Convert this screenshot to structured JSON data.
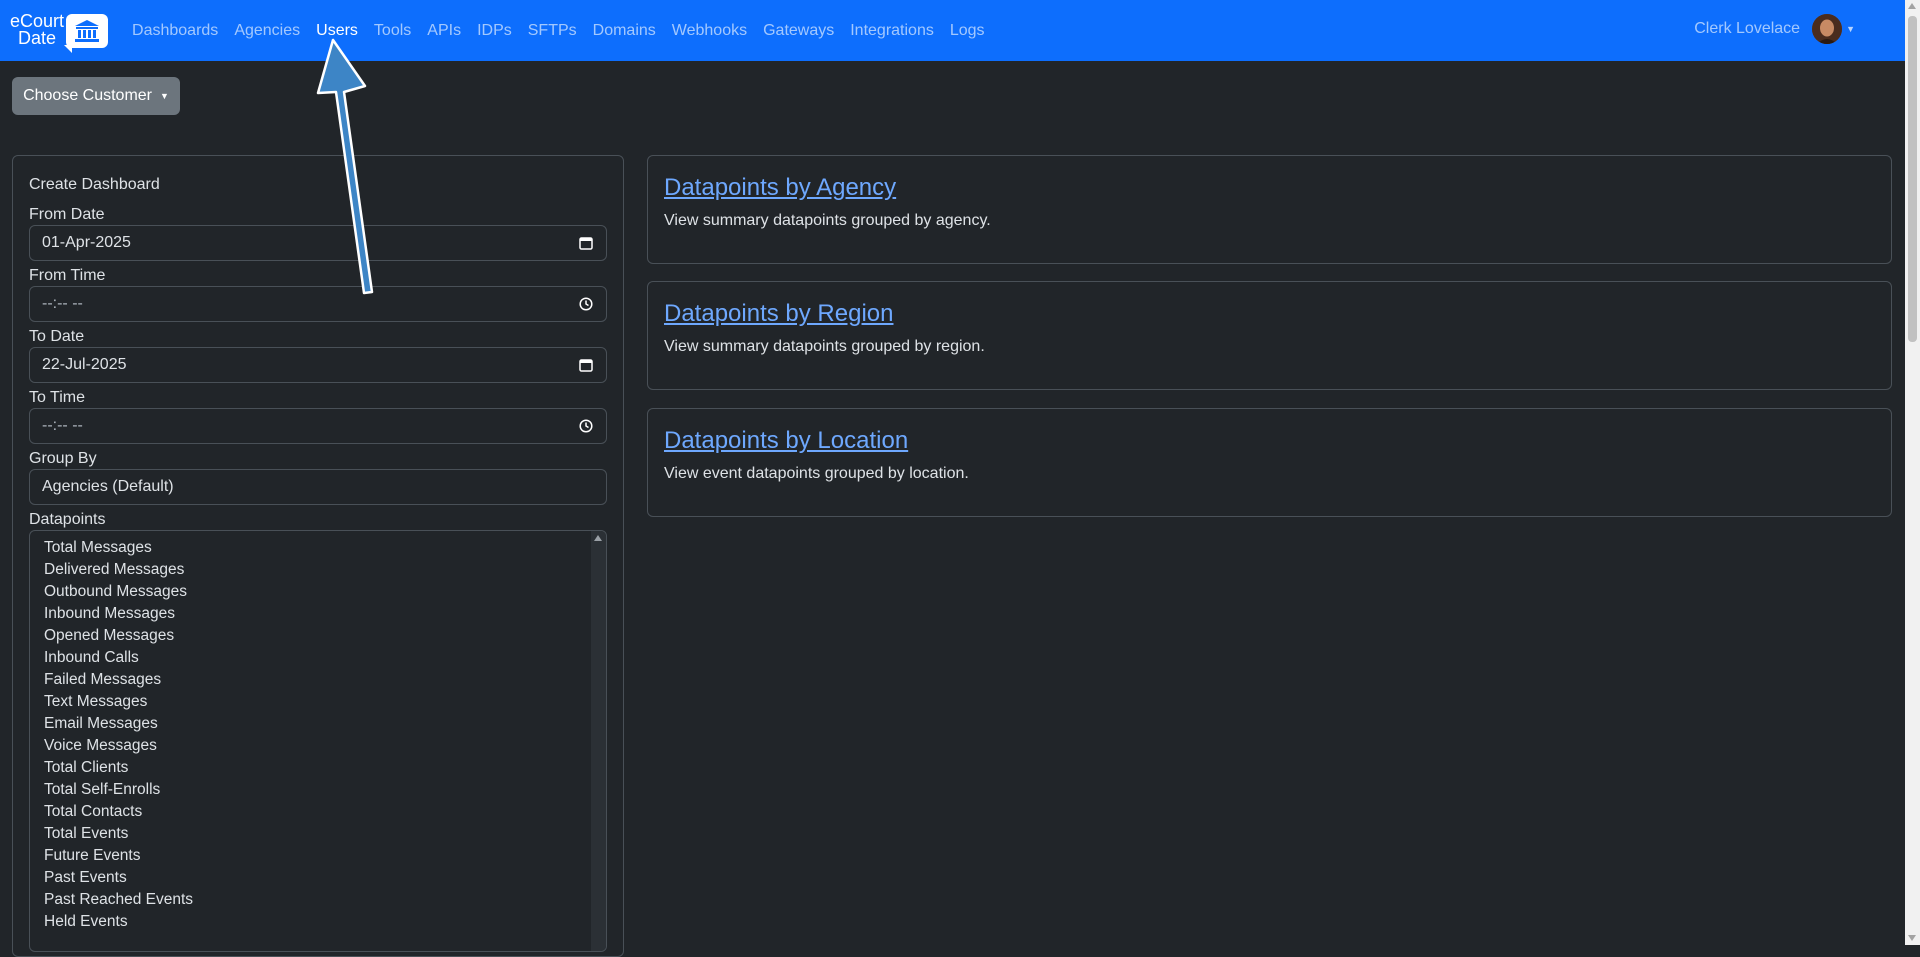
{
  "brand": {
    "line1": "eCourt",
    "line2": "Date"
  },
  "nav": {
    "items": [
      "Dashboards",
      "Agencies",
      "Users",
      "Tools",
      "APIs",
      "IDPs",
      "SFTPs",
      "Domains",
      "Webhooks",
      "Gateways",
      "Integrations",
      "Logs"
    ],
    "active": "Users"
  },
  "user": {
    "name": "Clerk Lovelace"
  },
  "customer": {
    "label": "Choose Customer"
  },
  "form": {
    "title": "Create Dashboard",
    "from_date": {
      "label": "From Date",
      "value": "01-Apr-2025"
    },
    "from_time": {
      "label": "From Time",
      "placeholder": "--:-- --"
    },
    "to_date": {
      "label": "To Date",
      "value": "22-Jul-2025"
    },
    "to_time": {
      "label": "To Time",
      "placeholder": "--:-- --"
    },
    "group_by": {
      "label": "Group By",
      "value": "Agencies (Default)"
    },
    "datapoints": {
      "label": "Datapoints",
      "options": [
        "Total Messages",
        "Delivered Messages",
        "Outbound Messages",
        "Inbound Messages",
        "Opened Messages",
        "Inbound Calls",
        "Failed Messages",
        "Text Messages",
        "Email Messages",
        "Voice Messages",
        "Total Clients",
        "Total Self-Enrolls",
        "Total Contacts",
        "Total Events",
        "Future Events",
        "Past Events",
        "Past Reached Events",
        "Held Events"
      ]
    }
  },
  "cards": [
    {
      "title": "Datapoints by Agency",
      "text": "View summary datapoints grouped by agency."
    },
    {
      "title": "Datapoints by Region",
      "text": "View summary datapoints grouped by region."
    },
    {
      "title": "Datapoints by Location",
      "text": "View event datapoints grouped by location."
    }
  ],
  "colors": {
    "navbar": "#0d6efd",
    "background": "#212529",
    "link": "#6ea8fe",
    "annotation_arrow": "#3d85c6"
  }
}
